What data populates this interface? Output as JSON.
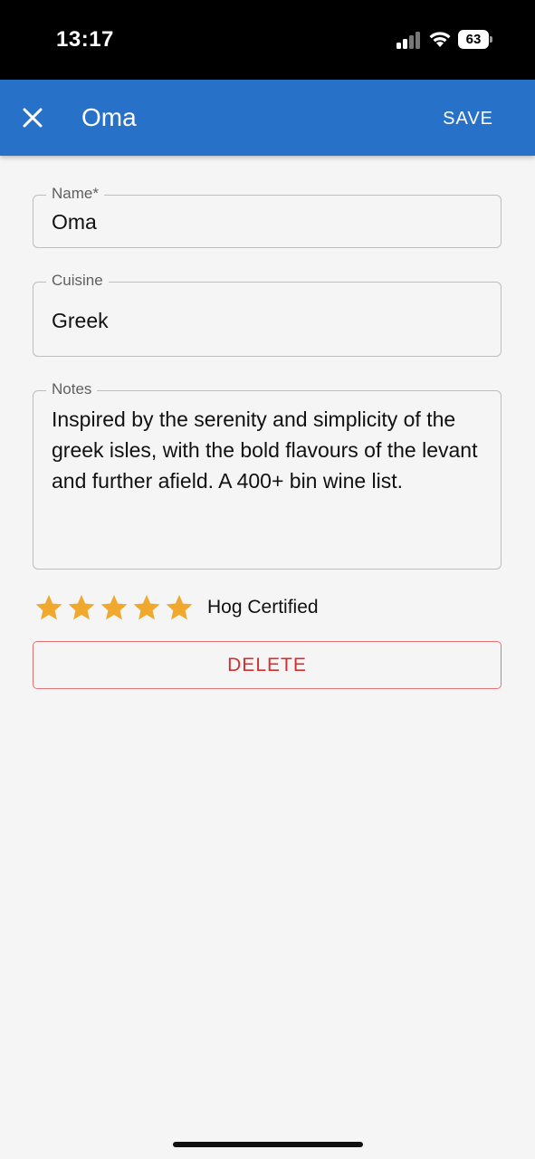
{
  "status_bar": {
    "time": "13:17",
    "battery": "63",
    "icons": [
      "signal-icon",
      "wifi-icon",
      "battery-icon"
    ]
  },
  "app_bar": {
    "close_icon": "close-icon",
    "title": "Oma",
    "save_label": "SAVE",
    "color": "#2871c8"
  },
  "form": {
    "name": {
      "label": "Name*",
      "value": "Oma"
    },
    "cuisine": {
      "label": "Cuisine",
      "value": "Greek"
    },
    "notes": {
      "label": "Notes",
      "value": "Inspired by the serenity and simplicity of the greek isles, with the bold flavours of the levant and further afield. A 400+ bin wine list."
    }
  },
  "rating": {
    "stars": 5,
    "max_stars": 5,
    "star_color": "#f0a92e",
    "label": "Hog Certified"
  },
  "delete_label": "DELETE",
  "delete_color": "#d32f2f"
}
